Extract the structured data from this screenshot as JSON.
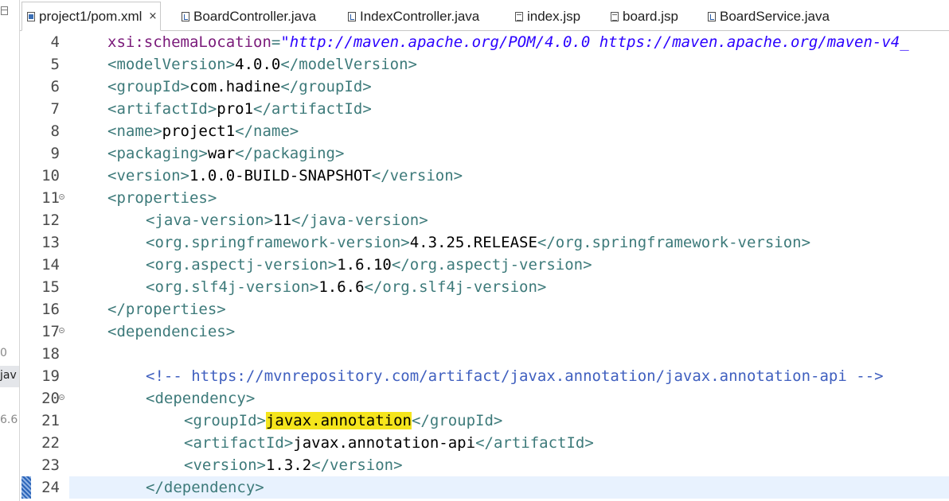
{
  "left_panel": {
    "fragments": [
      "0",
      "jav",
      "6.6"
    ]
  },
  "tabs": [
    {
      "label": "project1/pom.xml",
      "icon": "xml-file-icon",
      "active": true,
      "close": "×"
    },
    {
      "label": "BoardController.java",
      "icon": "java-file-icon"
    },
    {
      "label": "IndexController.java",
      "icon": "java-file-icon"
    },
    {
      "label": "index.jsp",
      "icon": "jsp-file-icon"
    },
    {
      "label": "board.jsp",
      "icon": "jsp-file-icon"
    },
    {
      "label": "BoardService.java",
      "icon": "java-file-icon"
    }
  ],
  "editor": {
    "current_line": 24,
    "lines": [
      {
        "num": "4",
        "indent": 1,
        "p": [
          "",
          "xsi:schemaLocation",
          "=",
          "\"http://maven.apache.org/POM/4.0.0 https://maven.apache.org/maven-v4_",
          ""
        ]
      },
      {
        "num": "5",
        "indent": 1,
        "p": [
          "<modelVersion>",
          "4.0.0",
          "</modelVersion>"
        ]
      },
      {
        "num": "6",
        "indent": 1,
        "p": [
          "<groupId>",
          "com.hadine",
          "</groupId>"
        ]
      },
      {
        "num": "7",
        "indent": 1,
        "p": [
          "<artifactId>",
          "pro1",
          "</artifactId>"
        ]
      },
      {
        "num": "8",
        "indent": 1,
        "p": [
          "<name>",
          "project1",
          "</name>"
        ]
      },
      {
        "num": "9",
        "indent": 1,
        "p": [
          "<packaging>",
          "war",
          "</packaging>"
        ]
      },
      {
        "num": "10",
        "indent": 1,
        "p": [
          "<version>",
          "1.0.0-BUILD-SNAPSHOT",
          "</version>"
        ]
      },
      {
        "num": "11",
        "indent": 1,
        "fold": true,
        "p": [
          "<properties>"
        ]
      },
      {
        "num": "12",
        "indent": 2,
        "p": [
          "<java-version>",
          "11",
          "</java-version>"
        ]
      },
      {
        "num": "13",
        "indent": 2,
        "p": [
          "<org.springframework-version>",
          "4.3.25.RELEASE",
          "</org.springframework-version>"
        ]
      },
      {
        "num": "14",
        "indent": 2,
        "p": [
          "<org.aspectj-version>",
          "1.6.10",
          "</org.aspectj-version>"
        ]
      },
      {
        "num": "15",
        "indent": 2,
        "p": [
          "<org.slf4j-version>",
          "1.6.6",
          "</org.slf4j-version>"
        ]
      },
      {
        "num": "16",
        "indent": 1,
        "p": [
          "</properties>"
        ]
      },
      {
        "num": "17",
        "indent": 1,
        "fold": true,
        "p": [
          "<dependencies>"
        ]
      },
      {
        "num": "18",
        "indent": 0,
        "p": [
          ""
        ]
      },
      {
        "num": "19",
        "indent": 2,
        "comment": true,
        "p": [
          "<!-- https://mvnrepository.com/artifact/javax.annotation/javax.annotation-api -->"
        ]
      },
      {
        "num": "20",
        "indent": 2,
        "fold": true,
        "p": [
          "<dependency>"
        ]
      },
      {
        "num": "21",
        "indent": 3,
        "highlight": true,
        "p": [
          "<groupId>",
          "javax.annotation",
          "</groupId>"
        ]
      },
      {
        "num": "22",
        "indent": 3,
        "p": [
          "<artifactId>",
          "javax.annotation-api",
          "</artifactId>"
        ]
      },
      {
        "num": "23",
        "indent": 3,
        "p": [
          "<version>",
          "1.3.2",
          "</version>"
        ]
      },
      {
        "num": "24",
        "indent": 2,
        "p": [
          "</dependency>"
        ]
      }
    ]
  },
  "colors": {
    "tag": "#3d7a7a",
    "text": "#000000",
    "attribute": "#7a1a7a",
    "attribute_value": "#2a00ff",
    "comment": "#3f5fbf",
    "highlight": "#f5e51c",
    "current_line": "#e8f2fe"
  }
}
